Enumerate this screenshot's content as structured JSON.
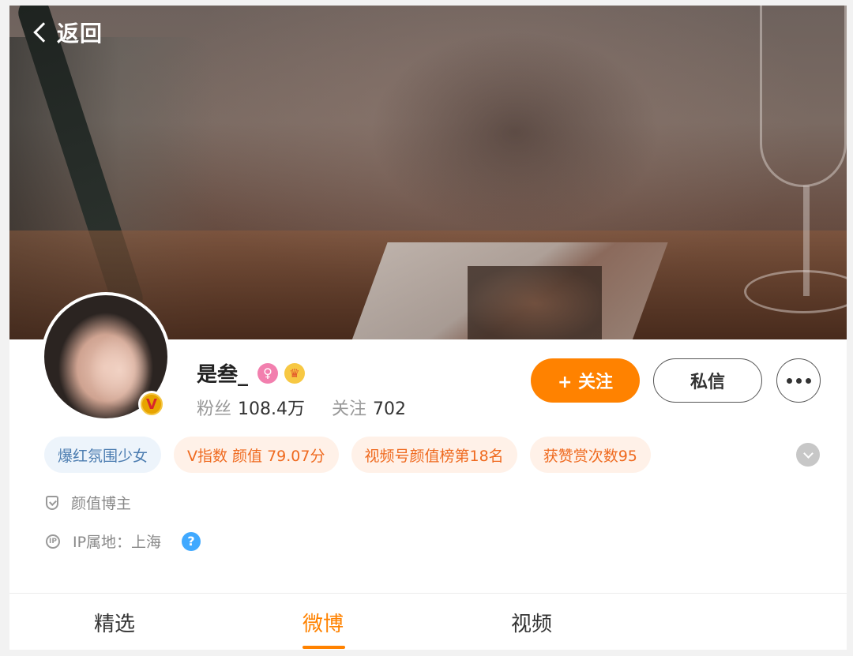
{
  "header": {
    "back_label": "返回"
  },
  "profile": {
    "name": "是叁_",
    "gender_icon": "female-icon",
    "vip_icon": "crown-icon",
    "verified_badge": "V",
    "followers_label": "粉丝",
    "followers_value": "108.4万",
    "following_label": "关注",
    "following_value": "702"
  },
  "actions": {
    "follow_label": "+ 关注",
    "message_label": "私信"
  },
  "tags": [
    {
      "label": "爆红氛围少女"
    },
    {
      "label": "V指数 颜值 79.07分"
    },
    {
      "label": "视频号颜值榜第18名"
    },
    {
      "label": "获赞赏次数95"
    }
  ],
  "info": {
    "category": "颜值博主",
    "ip_location": "IP属地：上海",
    "help_symbol": "?"
  },
  "tabs": [
    {
      "label": "精选"
    },
    {
      "label": "微博"
    },
    {
      "label": "视频"
    }
  ],
  "colors": {
    "accent": "#ff8200",
    "tag_blue_text": "#4b7cb0",
    "tag_orange_text": "#ef6a1f"
  }
}
